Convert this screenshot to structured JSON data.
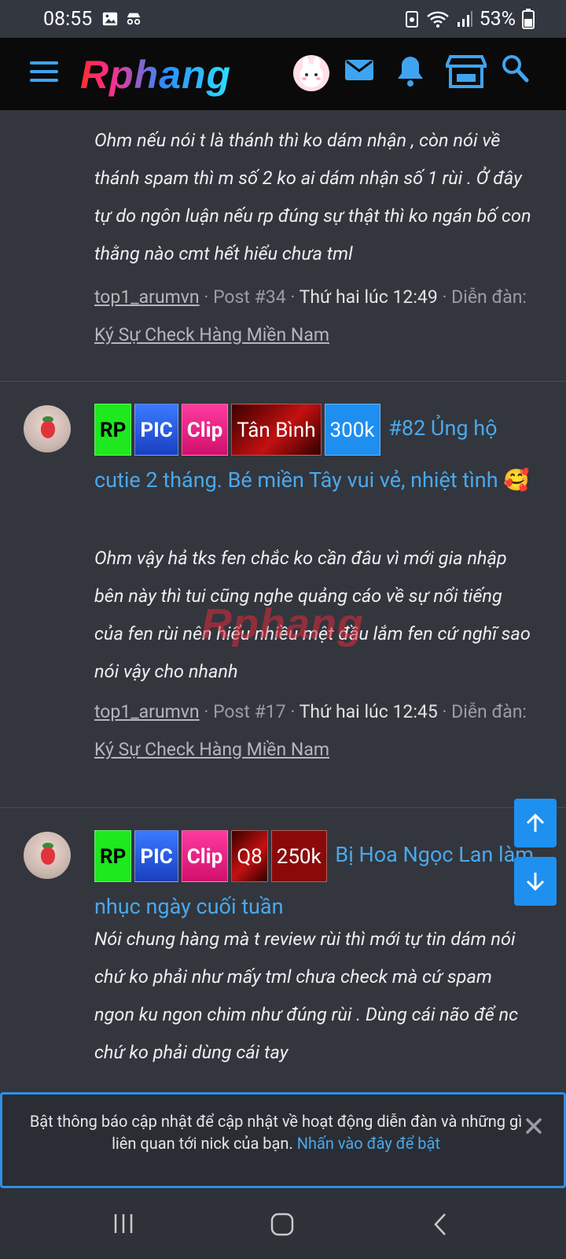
{
  "status_bar": {
    "time": "08:55",
    "battery": "53%"
  },
  "header": {
    "logo": "Rphang"
  },
  "posts": [
    {
      "snippet": "Ohm nếu nói t là thánh thì ko dám nhận , còn nói về thánh spam thì m số 2 ko ai dám nhận số 1 rùi . Ở đây tự do ngôn luận nếu rp đúng sự thật thì ko ngán bố con thằng nào cmt hết hiểu chưa tml",
      "author": "top1_arumvn",
      "post_no": "Post #34",
      "time": "Thứ hai lúc 12:49",
      "forum_label": "Diễn đàn:",
      "forum": "Ký Sự Check Hàng Miền Nam"
    },
    {
      "tags": [
        "RP",
        "PIC",
        "Clip",
        "Tân Bình",
        "300k"
      ],
      "title": "#82 Ủng hộ cutie 2 tháng. Bé miền Tây vui vẻ, nhiệt tình 🥰",
      "snippet": "Ohm vậy hả tks fen chắc ko cần đâu vì mới gia nhập bên này thì tui cũng nghe quảng cáo về sự nổi tiếng của fen rùi nên hiểu nhiều mệt đầu lắm fen cứ nghĩ sao nói vậy cho nhanh",
      "author": "top1_arumvn",
      "post_no": "Post #17",
      "time": "Thứ hai lúc 12:45",
      "forum_label": "Diễn đàn:",
      "forum": "Ký Sự Check Hàng Miền Nam"
    },
    {
      "tags": [
        "RP",
        "PIC",
        "Clip",
        "Q8",
        "250k"
      ],
      "title": "Bị Hoa Ngọc Lan làm nhục ngày cuối tuần",
      "snippet": "Nói chung hàng mà t review rùi thì mới tự tin dám nói chứ ko phải như mấy tml chưa check mà cứ spam ngon ku ngon chim như đúng rùi . Dùng cái não để nc chứ ko phải dùng cái tay"
    }
  ],
  "notice": {
    "text": "Bật thông báo cập nhật để cập nhật về hoạt động diễn đàn và những gì liên quan tới nick của bạn.",
    "link": "Nhấn vào đây để bật"
  },
  "watermark": "Rphang",
  "colors": {
    "accent": "#3fa4f0",
    "background": "#33363d",
    "header": "#0a0a0a"
  }
}
